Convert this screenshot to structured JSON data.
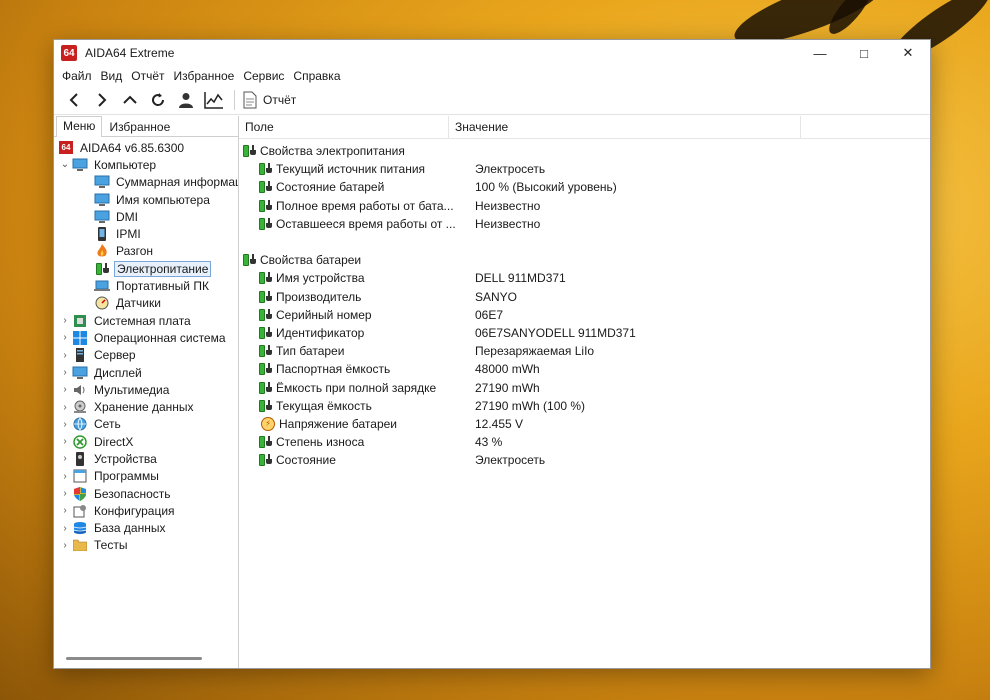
{
  "window": {
    "title": "AIDA64 Extreme",
    "logo_text": "64"
  },
  "menu": [
    "Файл",
    "Вид",
    "Отчёт",
    "Избранное",
    "Сервис",
    "Справка"
  ],
  "toolbar": {
    "report_label": "Отчёт"
  },
  "left_tabs": [
    "Меню",
    "Избранное"
  ],
  "tree": {
    "root": "AIDA64 v6.85.6300",
    "computer": "Компьютер",
    "computer_children": [
      "Суммарная информация",
      "Имя компьютера",
      "DMI",
      "IPMI",
      "Разгон",
      "Электропитание",
      "Портативный ПК",
      "Датчики"
    ],
    "sections": [
      "Системная плата",
      "Операционная система",
      "Сервер",
      "Дисплей",
      "Мультимедиа",
      "Хранение данных",
      "Сеть",
      "DirectX",
      "Устройства",
      "Программы",
      "Безопасность",
      "Конфигурация",
      "База данных",
      "Тесты"
    ]
  },
  "columns": {
    "field": "Поле",
    "value": "Значение"
  },
  "power_group": {
    "title": "Свойства электропитания",
    "rows": [
      {
        "field": "Текущий источник питания",
        "value": "Электросеть"
      },
      {
        "field": "Состояние батарей",
        "value": "100 % (Высокий уровень)"
      },
      {
        "field": "Полное время работы от бата...",
        "value": "Неизвестно"
      },
      {
        "field": "Оставшееся время работы от ...",
        "value": "Неизвестно"
      }
    ]
  },
  "battery_group": {
    "title": "Свойства батареи",
    "rows": [
      {
        "field": "Имя устройства",
        "value": "DELL 911MD371"
      },
      {
        "field": "Производитель",
        "value": "SANYO"
      },
      {
        "field": "Серийный номер",
        "value": "06E7"
      },
      {
        "field": "Идентификатор",
        "value": "06E7SANYODELL 911MD371"
      },
      {
        "field": "Тип батареи",
        "value": "Перезаряжаемая LiIo"
      },
      {
        "field": "Паспортная ёмкость",
        "value": "48000 mWh"
      },
      {
        "field": "Ёмкость при полной зарядке",
        "value": "27190 mWh"
      },
      {
        "field": "Текущая ёмкость",
        "value": "27190 mWh  (100 %)"
      },
      {
        "field": "Напряжение батареи",
        "value": "12.455 V"
      },
      {
        "field": "Степень износа",
        "value": "43 %"
      },
      {
        "field": "Состояние",
        "value": "Электросеть"
      }
    ]
  }
}
